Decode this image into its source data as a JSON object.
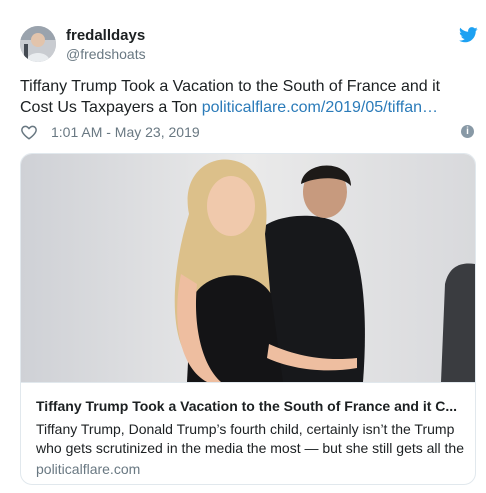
{
  "user": {
    "display_name": "fredalldays",
    "handle": "@fredshoats",
    "avatar_icon": "user-avatar"
  },
  "tweet": {
    "text": "Tiffany Trump Took a Vacation to the South of France and it Cost Us Taxpayers a Ton ",
    "link_text": "politicalflare.com/2019/05/tiffan…",
    "timestamp": "1:01 AM - May 23, 2019"
  },
  "card": {
    "title": "Tiffany Trump Took a Vacation to the South of France and it C...",
    "description": "Tiffany Trump, Donald Trump’s fourth child, certainly isn’t the Trump who gets scrutinized in the media the most — but she still gets all the",
    "domain": "politicalflare.com"
  },
  "colors": {
    "link": "#2b7bb9",
    "twitter_blue": "#1da1f2",
    "muted": "#697882",
    "text": "#1c2022",
    "border": "#e1e8ed"
  },
  "icons": [
    "twitter-bird-icon",
    "heart-icon",
    "info-icon"
  ]
}
